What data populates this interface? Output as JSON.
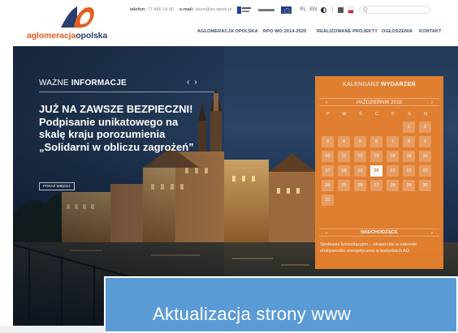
{
  "header": {
    "logo": {
      "part1": "aglomeracja",
      "part2": "opolska"
    },
    "contact": {
      "phone_label": "telefon:",
      "phone": "77 446 14 00",
      "email_label": "e-mail:",
      "email": "biuro@ao.opole.pl"
    },
    "languages": [
      "PL",
      "EN"
    ],
    "search_placeholder": "Q"
  },
  "nav": {
    "items": [
      "AGLOMERACJA OPOLSKA",
      "RPO WO 2014-2020",
      "REALIZOWANE PROJEKTY",
      "OGŁOSZENIA",
      "KONTAKT"
    ]
  },
  "news": {
    "label_light": "WAŻNE",
    "label_bold": "INFORMACJE",
    "prev": "‹",
    "next": "›",
    "headline_bold": "JUŻ NA ZAWSZE BEZPIECZNI!",
    "headline_rest": "Podpisanie unikatowego na skalę kraju porozumienia „Solidarni w obliczu zagrożeń”",
    "more": "POKAŻ WIĘCEJ"
  },
  "calendar": {
    "title_light": "KALENDARZ",
    "title_bold": "WYDARZEŃ",
    "month": "PAŹDZIERNIK 2016",
    "prev": "‹",
    "next": "›",
    "weekdays": [
      "P",
      "W",
      "Ś",
      "C",
      "P",
      "S",
      "N"
    ],
    "first_weekday_index": 5,
    "days_in_month": 31,
    "highlighted_day": 20,
    "upcoming_label": "NADCHODZĄCE",
    "upcoming_text": "Spotkanie konsultacyjno – eksperckie w zakresie efektywności energetycznej w budynkach AO"
  },
  "banner": {
    "text": "Aktualizacja strony www"
  },
  "colors": {
    "accent_orange": "#e8822f",
    "brand_navy": "#2c3e6b",
    "banner_blue": "#5b9bd5"
  }
}
